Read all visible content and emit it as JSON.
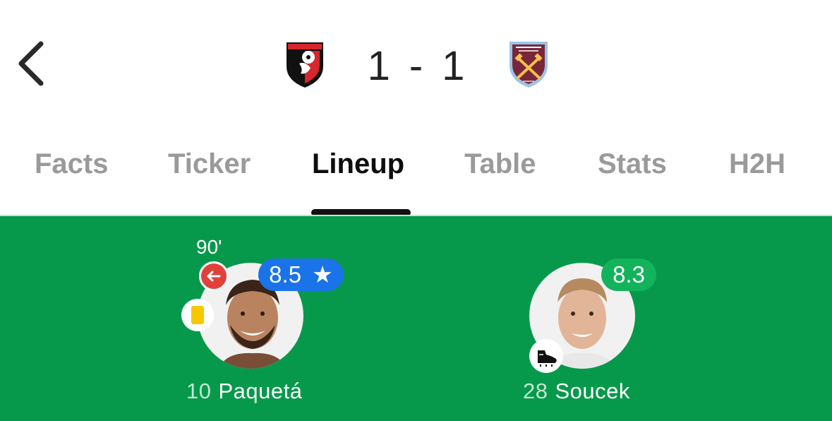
{
  "match": {
    "home_team": {
      "icon": "afc-bournemouth-crest-icon"
    },
    "away_team": {
      "icon": "west-ham-united-crest-icon"
    },
    "score": {
      "home": "1",
      "separator": "-",
      "away": "1"
    }
  },
  "tabs": [
    {
      "label": "Facts"
    },
    {
      "label": "Ticker"
    },
    {
      "label": "Lineup",
      "active": true
    },
    {
      "label": "Table"
    },
    {
      "label": "Stats"
    },
    {
      "label": "H2H"
    }
  ],
  "players": [
    {
      "number": "10",
      "name": "Paquetá",
      "rating": "8.5",
      "rating_star": "★",
      "sub_time": "90'",
      "icons": [
        "substituted-off-icon",
        "yellow-card-icon",
        "star-icon"
      ]
    },
    {
      "number": "28",
      "name": "Soucek",
      "rating": "8.3",
      "icons": [
        "goal-boot-icon"
      ]
    }
  ],
  "colors": {
    "pitch": "#07994b",
    "rating_top": "#1a73e8",
    "rating_good": "#12b35a",
    "sub_off": "#e0413b",
    "yellow_card": "#f7c800",
    "tab_inactive": "#9a9a9a",
    "tab_active": "#0d0d0d"
  }
}
